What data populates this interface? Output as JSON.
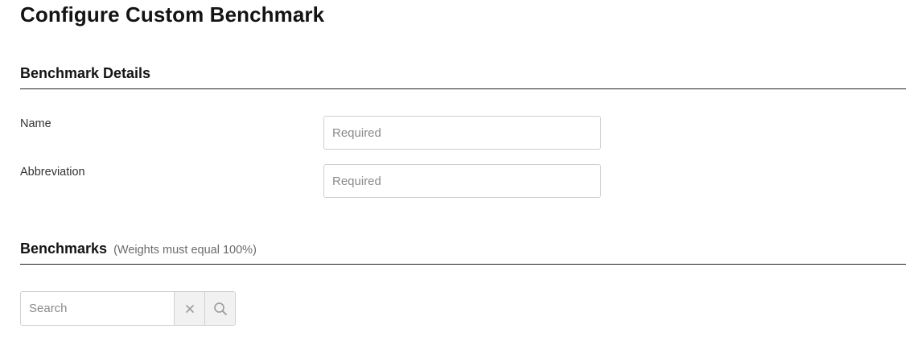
{
  "page": {
    "title": "Configure Custom Benchmark"
  },
  "details": {
    "title": "Benchmark Details",
    "name_label": "Name",
    "name_placeholder": "Required",
    "abbreviation_label": "Abbreviation",
    "abbreviation_placeholder": "Required"
  },
  "benchmarks": {
    "title": "Benchmarks",
    "note": "(Weights must equal 100%)",
    "search_placeholder": "Search",
    "clear_icon": "close-icon",
    "search_icon": "search-icon"
  }
}
